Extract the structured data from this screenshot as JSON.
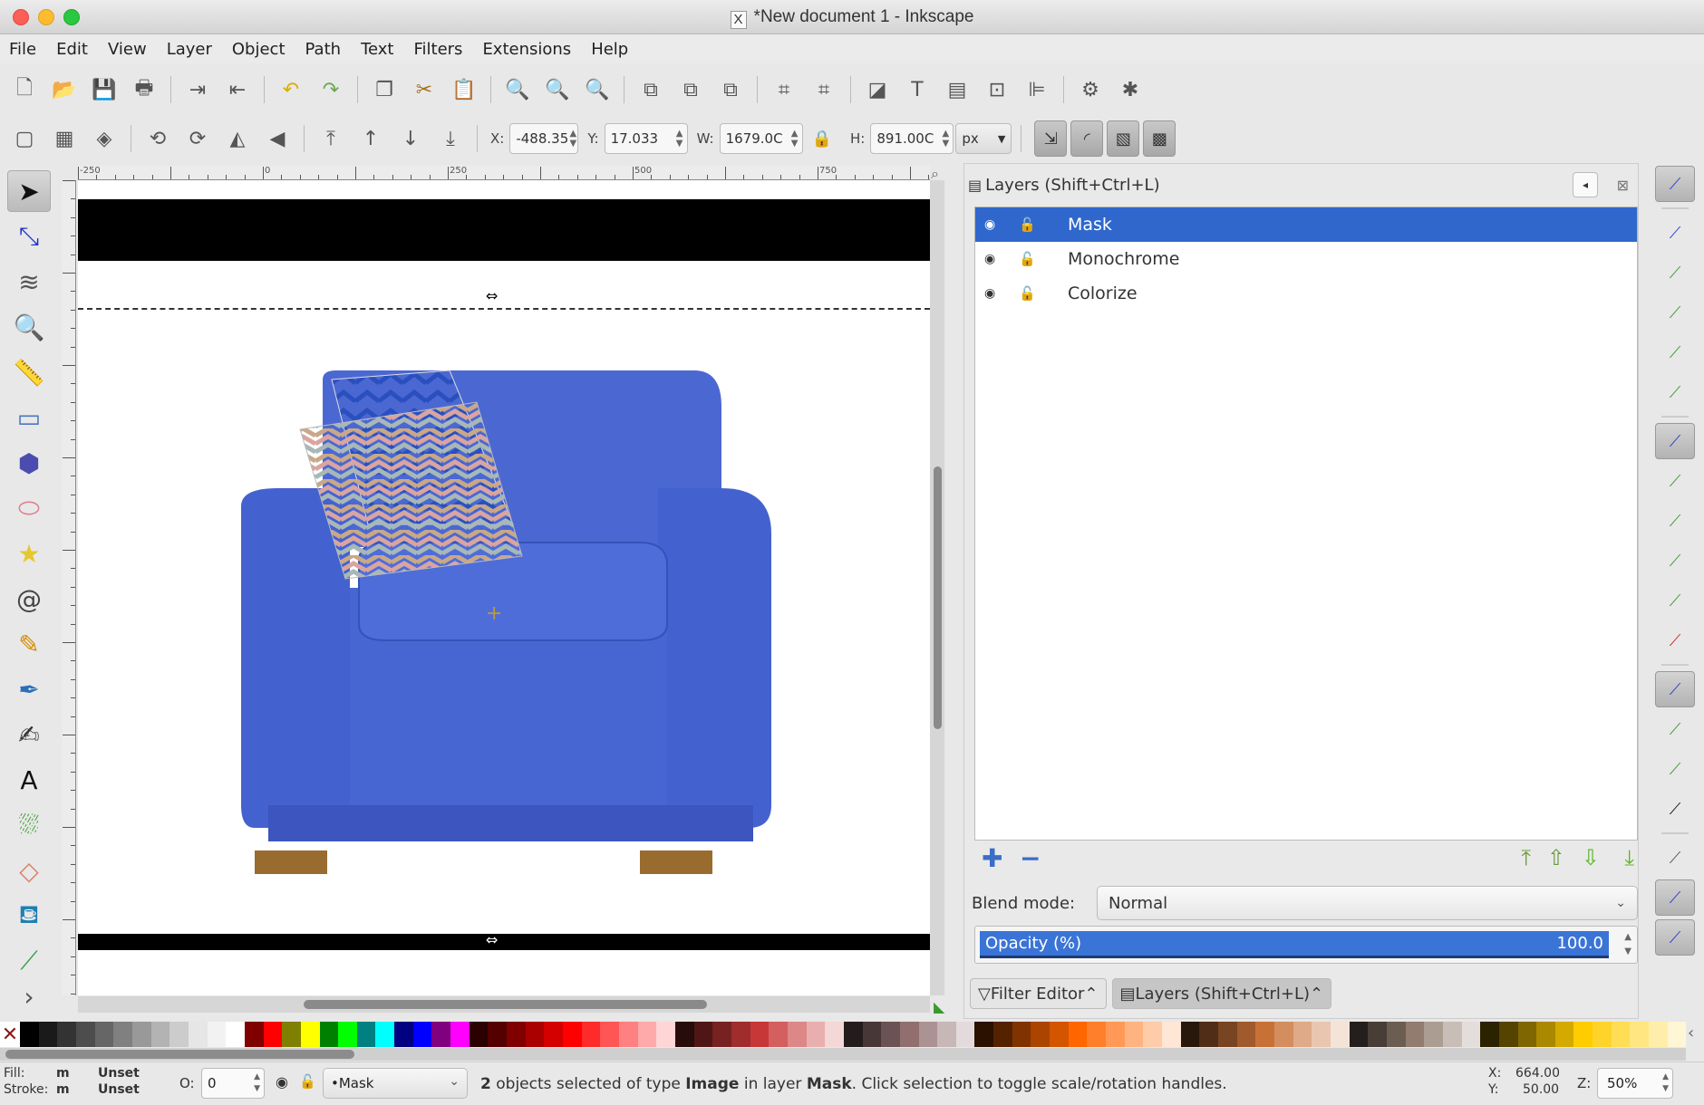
{
  "window": {
    "title": "*New document 1 - Inkscape",
    "title_icon": "x11-icon"
  },
  "menu": [
    "File",
    "Edit",
    "View",
    "Layer",
    "Object",
    "Path",
    "Text",
    "Filters",
    "Extensions",
    "Help"
  ],
  "toolbar_commands": [
    {
      "name": "new-document-icon",
      "glyph": "🗋"
    },
    {
      "name": "open-icon",
      "glyph": "📂"
    },
    {
      "name": "save-icon",
      "glyph": "💾"
    },
    {
      "name": "print-icon",
      "glyph": "🖶"
    },
    {
      "sep": true
    },
    {
      "name": "import-icon",
      "glyph": "⇥"
    },
    {
      "name": "export-icon",
      "glyph": "⇤"
    },
    {
      "sep": true
    },
    {
      "name": "undo-icon",
      "glyph": "↶",
      "color": "#d7b000"
    },
    {
      "name": "redo-icon",
      "glyph": "↷",
      "color": "#6aa84f"
    },
    {
      "sep": true
    },
    {
      "name": "copy-icon",
      "glyph": "❐"
    },
    {
      "name": "cut-icon",
      "glyph": "✂",
      "color": "#a6701d"
    },
    {
      "name": "paste-icon",
      "glyph": "📋"
    },
    {
      "sep": true
    },
    {
      "name": "zoom-selection-icon",
      "glyph": "🔍"
    },
    {
      "name": "zoom-drawing-icon",
      "glyph": "🔍"
    },
    {
      "name": "zoom-page-icon",
      "glyph": "🔍"
    },
    {
      "sep": true
    },
    {
      "name": "duplicate-icon",
      "glyph": "⧉"
    },
    {
      "name": "clone-icon",
      "glyph": "⧉"
    },
    {
      "name": "unlink-clone-icon",
      "glyph": "⧉"
    },
    {
      "sep": true
    },
    {
      "name": "group-icon",
      "glyph": "⌗"
    },
    {
      "name": "ungroup-icon",
      "glyph": "⌗"
    },
    {
      "sep": true
    },
    {
      "name": "fill-stroke-icon",
      "glyph": "◪"
    },
    {
      "name": "text-font-icon",
      "glyph": "T"
    },
    {
      "name": "layers-icon",
      "glyph": "▤"
    },
    {
      "name": "xml-editor-icon",
      "glyph": "⊡"
    },
    {
      "name": "align-distribute-icon",
      "glyph": "⊫"
    },
    {
      "sep": true
    },
    {
      "name": "document-properties-icon",
      "glyph": "⚙"
    },
    {
      "name": "preferences-icon",
      "glyph": "✱"
    }
  ],
  "toolbar_select": {
    "buttons": [
      {
        "name": "select-all-icon",
        "glyph": "▢"
      },
      {
        "name": "select-all-layers-icon",
        "glyph": "▦"
      },
      {
        "name": "deselect-icon",
        "glyph": "◈"
      },
      {
        "sep": true
      },
      {
        "name": "rotate-ccw-icon",
        "glyph": "⟲"
      },
      {
        "name": "rotate-cw-icon",
        "glyph": "⟳"
      },
      {
        "name": "flip-horizontal-icon",
        "glyph": "◭"
      },
      {
        "name": "flip-vertical-icon",
        "glyph": "◀"
      },
      {
        "sep": true
      },
      {
        "name": "raise-top-icon",
        "glyph": "⤒"
      },
      {
        "name": "raise-icon",
        "glyph": "↑"
      },
      {
        "name": "lower-icon",
        "glyph": "↓"
      },
      {
        "name": "lower-bottom-icon",
        "glyph": "⤓"
      }
    ],
    "x_label": "X:",
    "x_value": "-488.35",
    "y_label": "Y:",
    "y_value": "17.033",
    "w_label": "W:",
    "w_value": "1679.0C",
    "h_label": "H:",
    "h_value": "891.00C",
    "unit": "px",
    "transform_toggles": [
      {
        "name": "scale-stroke-icon",
        "glyph": "⇲"
      },
      {
        "name": "scale-corners-icon",
        "glyph": "◜"
      },
      {
        "name": "transform-gradients-icon",
        "glyph": "▧"
      },
      {
        "name": "transform-patterns-icon",
        "glyph": "▩"
      }
    ]
  },
  "tools": [
    {
      "name": "selector-tool",
      "glyph": "➤",
      "active": true,
      "color": "#111"
    },
    {
      "name": "node-tool",
      "glyph": "⤡",
      "color": "#2233cc"
    },
    {
      "name": "tweak-tool",
      "glyph": "≋",
      "color": "#555"
    },
    {
      "name": "zoom-tool",
      "glyph": "🔍",
      "color": "#2a5da8"
    },
    {
      "name": "measure-tool",
      "glyph": "📏",
      "color": "#a26"
    },
    {
      "name": "rectangle-tool",
      "glyph": "▭",
      "color": "#4a78c2"
    },
    {
      "name": "3d-box-tool",
      "glyph": "⬢",
      "color": "#4b4bb0"
    },
    {
      "name": "ellipse-tool",
      "glyph": "⬭",
      "color": "#e07a8a"
    },
    {
      "name": "star-tool",
      "glyph": "★",
      "color": "#e5c830"
    },
    {
      "name": "spiral-tool",
      "glyph": "@",
      "color": "#444"
    },
    {
      "name": "pencil-tool",
      "glyph": "✎",
      "color": "#d48a00"
    },
    {
      "name": "pen-tool",
      "glyph": "✒",
      "color": "#2a6fb8"
    },
    {
      "name": "calligraphy-tool",
      "glyph": "✍",
      "color": "#333"
    },
    {
      "name": "text-tool",
      "glyph": "A",
      "color": "#111"
    },
    {
      "name": "spray-tool",
      "glyph": "⛆",
      "color": "#3a9b2c"
    },
    {
      "name": "eraser-tool",
      "glyph": "◇",
      "color": "#d8866a"
    },
    {
      "name": "paint-bucket-tool",
      "glyph": "⛾",
      "color": "#1c7fb5"
    },
    {
      "name": "connector-tool",
      "glyph": "⟋",
      "color": "#3aa14d"
    },
    {
      "name": "more-tools",
      "glyph": "›",
      "color": "#555"
    }
  ],
  "ruler_labels": [
    "-250",
    "0",
    "250",
    "500",
    "750"
  ],
  "dock": {
    "title": "Layers (Shift+Ctrl+L)",
    "layers": [
      {
        "name": "Mask",
        "selected": true
      },
      {
        "name": "Monochrome",
        "selected": false
      },
      {
        "name": "Colorize",
        "selected": false
      }
    ],
    "blend_label": "Blend mode:",
    "blend_value": "Normal",
    "opacity_label": "Opacity (%)",
    "opacity_value": "100.0",
    "opacity_fraction": 1.0,
    "tabs": [
      {
        "label": "Filter Editor",
        "icon": "filter-icon",
        "active": false
      },
      {
        "label": "Layers (Shift+Ctrl+L)",
        "icon": "layers-icon",
        "active": true
      }
    ]
  },
  "snap_controls": [
    {
      "name": "snap-enable-icon",
      "on": true,
      "color": "#2a3bd0"
    },
    {
      "sep": true
    },
    {
      "name": "snap-bbox-icon",
      "on": false,
      "color": "#2a3bd0"
    },
    {
      "name": "snap-bbox-edge-icon",
      "on": false,
      "color": "#3a9b2c"
    },
    {
      "name": "snap-bbox-corner-icon",
      "on": false,
      "color": "#3a9b2c"
    },
    {
      "name": "snap-bbox-midpoint-icon",
      "on": false,
      "color": "#3a9b2c"
    },
    {
      "name": "snap-bbox-center-icon",
      "on": false,
      "color": "#3a9b2c"
    },
    {
      "sep": true
    },
    {
      "name": "snap-nodes-icon",
      "on": true,
      "color": "#2a3bd0"
    },
    {
      "name": "snap-path-icon",
      "on": false,
      "color": "#3a9b2c"
    },
    {
      "name": "snap-intersection-icon",
      "on": false,
      "color": "#3a9b2c"
    },
    {
      "name": "snap-cusp-icon",
      "on": false,
      "color": "#3a9b2c"
    },
    {
      "name": "snap-smooth-icon",
      "on": false,
      "color": "#3a9b2c"
    },
    {
      "name": "snap-midpoint-icon",
      "on": false,
      "color": "#c62828"
    },
    {
      "sep": true
    },
    {
      "name": "snap-others-icon",
      "on": true,
      "color": "#2a3bd0"
    },
    {
      "name": "snap-center-icon",
      "on": false,
      "color": "#3a9b2c"
    },
    {
      "name": "snap-rotation-center-icon",
      "on": false,
      "color": "#3a9b2c"
    },
    {
      "name": "snap-text-baseline-icon",
      "on": false,
      "color": "#111"
    },
    {
      "sep": true
    },
    {
      "name": "snap-page-border-icon",
      "on": false,
      "color": "#555"
    },
    {
      "name": "snap-grid-icon",
      "on": true,
      "color": "#2a3bd0"
    },
    {
      "name": "snap-guide-icon",
      "on": true,
      "color": "#2a3bd0"
    }
  ],
  "palette_colors": [
    "#000000",
    "#1a1a1a",
    "#333333",
    "#4d4d4d",
    "#666666",
    "#808080",
    "#999999",
    "#b3b3b3",
    "#cccccc",
    "#e6e6e6",
    "#f2f2f2",
    "#ffffff",
    "#800000",
    "#ff0000",
    "#808000",
    "#ffff00",
    "#008000",
    "#00ff00",
    "#008080",
    "#00ffff",
    "#000080",
    "#0000ff",
    "#800080",
    "#ff00ff",
    "#2b0000",
    "#550000",
    "#800000",
    "#aa0000",
    "#d40000",
    "#ff0000",
    "#ff2a2a",
    "#ff5555",
    "#ff8080",
    "#ffaaaa",
    "#ffd5d5",
    "#280b0b",
    "#501616",
    "#782121",
    "#a02c2c",
    "#c83737",
    "#d35f5f",
    "#de8787",
    "#e9afaf",
    "#f4d7d7",
    "#241c1c",
    "#483737",
    "#6c5353",
    "#916f6f",
    "#ac9393",
    "#c8b7b7",
    "#e3dbdb",
    "#2b1100",
    "#552200",
    "#803300",
    "#aa4400",
    "#d45500",
    "#ff6600",
    "#ff7f2a",
    "#ff9955",
    "#ffb380",
    "#ffccaa",
    "#ffe6d5",
    "#28170b",
    "#502d16",
    "#784421",
    "#a05a2c",
    "#c87137",
    "#d38d5f",
    "#deaa87",
    "#e9c6af",
    "#f4e3d7",
    "#241f1c",
    "#483e37",
    "#6c5d53",
    "#917c6f",
    "#ac9d93",
    "#c8beb7",
    "#e3dedb",
    "#2b2200",
    "#554400",
    "#806600",
    "#aa8800",
    "#d4aa00",
    "#ffcc00",
    "#ffd42a",
    "#ffdd55",
    "#ffe680",
    "#ffeeaa",
    "#fff6d5"
  ],
  "status": {
    "fill_label": "Fill:",
    "fill_value": "m",
    "fill_state": "Unset",
    "stroke_label": "Stroke:",
    "stroke_value": "m",
    "stroke_state": "Unset",
    "opacity_label": "O:",
    "opacity_value": "0",
    "layer_select": "•Mask",
    "message_count": "2",
    "message_pre": " objects selected of type ",
    "message_type": "Image",
    "message_mid": " in layer ",
    "message_layer": "Mask",
    "message_post": ". Click selection to toggle scale/rotation handles.",
    "cursor_x_label": "X:",
    "cursor_x": "664.00",
    "cursor_y_label": "Y:",
    "cursor_y": "50.00",
    "zoom_label": "Z:",
    "zoom_value": "50%"
  }
}
